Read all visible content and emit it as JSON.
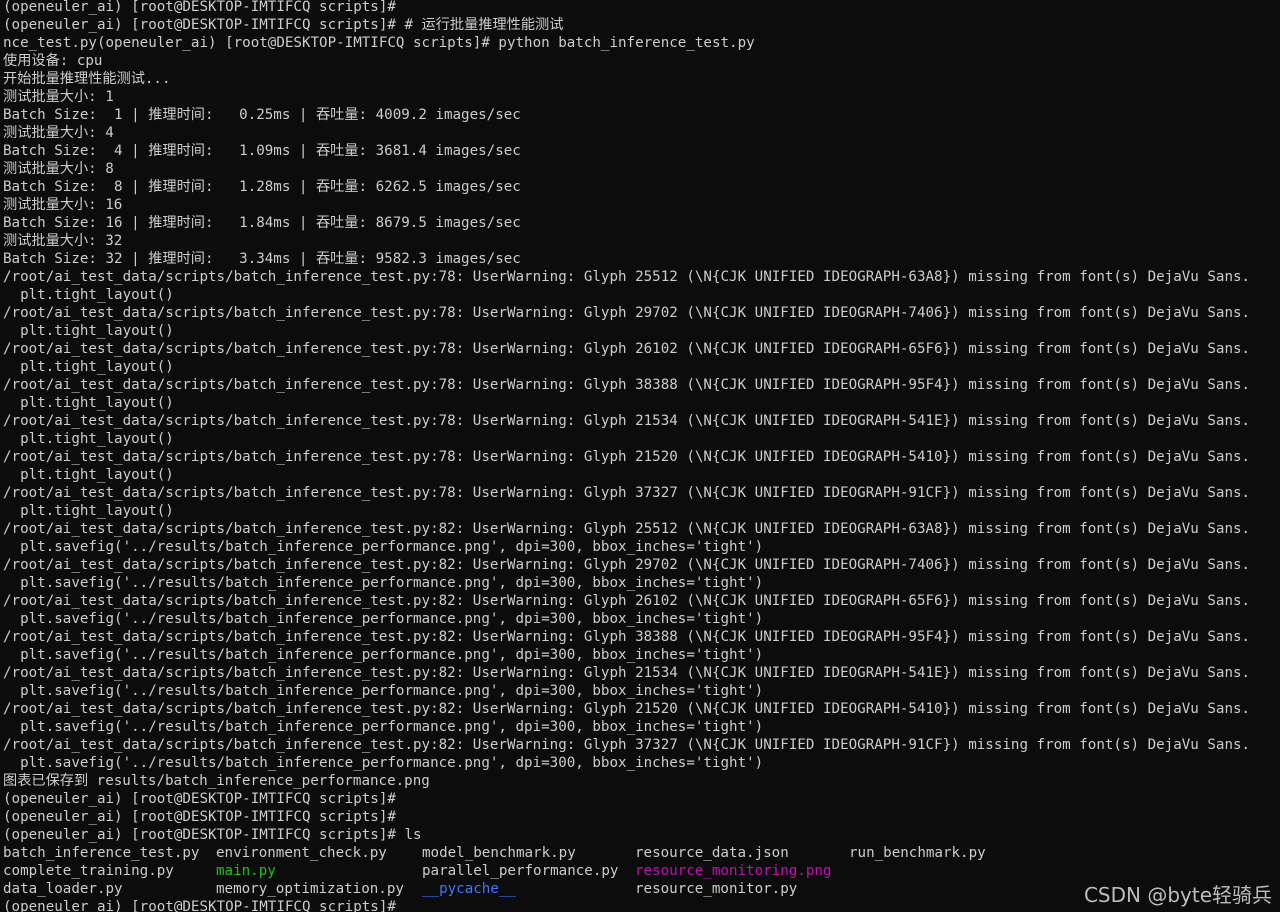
{
  "terminal": {
    "lines": [
      "(openeuler_ai) [root@DESKTOP-IMTIFCQ scripts]#",
      "(openeuler_ai) [root@DESKTOP-IMTIFCQ scripts]# # 运行批量推理性能测试",
      "nce_test.py(openeuler_ai) [root@DESKTOP-IMTIFCQ scripts]# python batch_inference_test.py",
      "使用设备: cpu",
      "开始批量推理性能测试...",
      "测试批量大小: 1",
      "Batch Size:  1 | 推理时间:   0.25ms | 吞吐量: 4009.2 images/sec",
      "测试批量大小: 4",
      "Batch Size:  4 | 推理时间:   1.09ms | 吞吐量: 3681.4 images/sec",
      "测试批量大小: 8",
      "Batch Size:  8 | 推理时间:   1.28ms | 吞吐量: 6262.5 images/sec",
      "测试批量大小: 16",
      "Batch Size: 16 | 推理时间:   1.84ms | 吞吐量: 8679.5 images/sec",
      "测试批量大小: 32",
      "Batch Size: 32 | 推理时间:   3.34ms | 吞吐量: 9582.3 images/sec",
      "/root/ai_test_data/scripts/batch_inference_test.py:78: UserWarning: Glyph 25512 (\\N{CJK UNIFIED IDEOGRAPH-63A8}) missing from font(s) DejaVu Sans.",
      "  plt.tight_layout()",
      "/root/ai_test_data/scripts/batch_inference_test.py:78: UserWarning: Glyph 29702 (\\N{CJK UNIFIED IDEOGRAPH-7406}) missing from font(s) DejaVu Sans.",
      "  plt.tight_layout()",
      "/root/ai_test_data/scripts/batch_inference_test.py:78: UserWarning: Glyph 26102 (\\N{CJK UNIFIED IDEOGRAPH-65F6}) missing from font(s) DejaVu Sans.",
      "  plt.tight_layout()",
      "/root/ai_test_data/scripts/batch_inference_test.py:78: UserWarning: Glyph 38388 (\\N{CJK UNIFIED IDEOGRAPH-95F4}) missing from font(s) DejaVu Sans.",
      "  plt.tight_layout()",
      "/root/ai_test_data/scripts/batch_inference_test.py:78: UserWarning: Glyph 21534 (\\N{CJK UNIFIED IDEOGRAPH-541E}) missing from font(s) DejaVu Sans.",
      "  plt.tight_layout()",
      "/root/ai_test_data/scripts/batch_inference_test.py:78: UserWarning: Glyph 21520 (\\N{CJK UNIFIED IDEOGRAPH-5410}) missing from font(s) DejaVu Sans.",
      "  plt.tight_layout()",
      "/root/ai_test_data/scripts/batch_inference_test.py:78: UserWarning: Glyph 37327 (\\N{CJK UNIFIED IDEOGRAPH-91CF}) missing from font(s) DejaVu Sans.",
      "  plt.tight_layout()",
      "/root/ai_test_data/scripts/batch_inference_test.py:82: UserWarning: Glyph 25512 (\\N{CJK UNIFIED IDEOGRAPH-63A8}) missing from font(s) DejaVu Sans.",
      "  plt.savefig('../results/batch_inference_performance.png', dpi=300, bbox_inches='tight')",
      "/root/ai_test_data/scripts/batch_inference_test.py:82: UserWarning: Glyph 29702 (\\N{CJK UNIFIED IDEOGRAPH-7406}) missing from font(s) DejaVu Sans.",
      "  plt.savefig('../results/batch_inference_performance.png', dpi=300, bbox_inches='tight')",
      "/root/ai_test_data/scripts/batch_inference_test.py:82: UserWarning: Glyph 26102 (\\N{CJK UNIFIED IDEOGRAPH-65F6}) missing from font(s) DejaVu Sans.",
      "  plt.savefig('../results/batch_inference_performance.png', dpi=300, bbox_inches='tight')",
      "/root/ai_test_data/scripts/batch_inference_test.py:82: UserWarning: Glyph 38388 (\\N{CJK UNIFIED IDEOGRAPH-95F4}) missing from font(s) DejaVu Sans.",
      "  plt.savefig('../results/batch_inference_performance.png', dpi=300, bbox_inches='tight')",
      "/root/ai_test_data/scripts/batch_inference_test.py:82: UserWarning: Glyph 21534 (\\N{CJK UNIFIED IDEOGRAPH-541E}) missing from font(s) DejaVu Sans.",
      "  plt.savefig('../results/batch_inference_performance.png', dpi=300, bbox_inches='tight')",
      "/root/ai_test_data/scripts/batch_inference_test.py:82: UserWarning: Glyph 21520 (\\N{CJK UNIFIED IDEOGRAPH-5410}) missing from font(s) DejaVu Sans.",
      "  plt.savefig('../results/batch_inference_performance.png', dpi=300, bbox_inches='tight')",
      "/root/ai_test_data/scripts/batch_inference_test.py:82: UserWarning: Glyph 37327 (\\N{CJK UNIFIED IDEOGRAPH-91CF}) missing from font(s) DejaVu Sans.",
      "  plt.savefig('../results/batch_inference_performance.png', dpi=300, bbox_inches='tight')",
      "图表已保存到 results/batch_inference_performance.png",
      "(openeuler_ai) [root@DESKTOP-IMTIFCQ scripts]#",
      "(openeuler_ai) [root@DESKTOP-IMTIFCQ scripts]#",
      "(openeuler_ai) [root@DESKTOP-IMTIFCQ scripts]# ls"
    ],
    "ls_rows": [
      [
        {
          "name": "batch_inference_test.py",
          "color": "default"
        },
        {
          "name": "environment_check.py",
          "color": "default"
        },
        {
          "name": "model_benchmark.py",
          "color": "default"
        },
        {
          "name": "resource_data.json",
          "color": "default"
        },
        {
          "name": "run_benchmark.py",
          "color": "default"
        }
      ],
      [
        {
          "name": "complete_training.py",
          "color": "default"
        },
        {
          "name": "main.py",
          "color": "green"
        },
        {
          "name": "parallel_performance.py",
          "color": "default"
        },
        {
          "name": "resource_monitoring.png",
          "color": "magenta"
        }
      ],
      [
        {
          "name": "data_loader.py",
          "color": "default"
        },
        {
          "name": "memory_optimization.py",
          "color": "default"
        },
        {
          "name": "__pycache__",
          "color": "blue"
        },
        {
          "name": "resource_monitor.py",
          "color": "default"
        }
      ]
    ],
    "last_prompt": "(openeuler_ai) [root@DESKTOP-IMTIFCQ scripts]#",
    "colors": {
      "background": "#0c0c0c",
      "foreground": "#cccccc",
      "green": "#16c60c",
      "magenta": "#c30eb4",
      "blue": "#3b78ff"
    }
  },
  "watermark": {
    "text": "CSDN @byte轻骑兵"
  }
}
